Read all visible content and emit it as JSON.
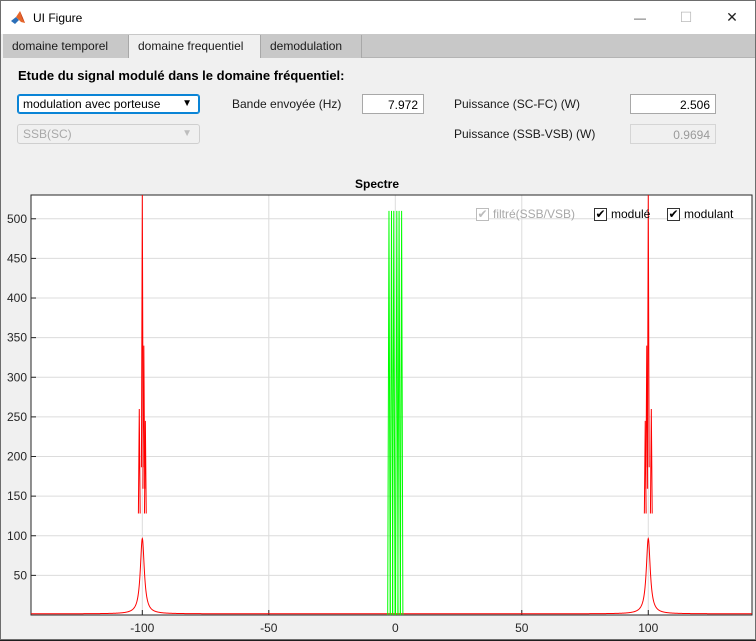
{
  "window": {
    "title": "UI Figure",
    "minimize_glyph": "—",
    "maximize_glyph": "☐",
    "close_glyph": "✕"
  },
  "tabs": [
    {
      "label": "domaine temporel",
      "active": false
    },
    {
      "label": "domaine frequentiel",
      "active": true
    },
    {
      "label": "demodulation",
      "active": false
    }
  ],
  "panel": {
    "heading": "Etude du signal modulé dans le domaine fréquentiel:",
    "modulation_select": {
      "value": "modulation avec porteuse"
    },
    "sideband_select": {
      "value": "SSB(SC)",
      "enabled": false
    },
    "bande_label": "Bande envoyée (Hz)",
    "bande_value": "7.972",
    "puissance_scfc_label": "Puissance (SC-FC) (W)",
    "puissance_scfc_value": "2.506",
    "puissance_ssb_label": "Puissance (SSB-VSB) (W)",
    "puissance_ssb_value": "0.9694"
  },
  "legend": {
    "filtre": {
      "label": "filtré(SSB/VSB)",
      "checked": true,
      "enabled": false
    },
    "module": {
      "label": "modulé",
      "checked": true,
      "enabled": true
    },
    "modulant": {
      "label": "modulant",
      "checked": true,
      "enabled": true
    }
  },
  "colors": {
    "module": "#ff0000",
    "modulant": "#00ff00",
    "grid": "#dcdcdc"
  },
  "chart_data": {
    "type": "line",
    "title": "Spectre",
    "xlabel": "",
    "ylabel": "",
    "xlim": [
      -144,
      141
    ],
    "ylim": [
      0,
      530
    ],
    "xticks": [
      -100,
      -50,
      0,
      50,
      100
    ],
    "yticks": [
      50,
      100,
      150,
      200,
      250,
      300,
      350,
      400,
      450,
      500
    ],
    "grid": true,
    "series": [
      {
        "name": "modulé",
        "color": "#ff0000",
        "carrier_hz": 100,
        "peaks": [
          {
            "x": -101.2,
            "y": 260
          },
          {
            "x": -100,
            "y": 530
          },
          {
            "x": -99.4,
            "y": 340
          },
          {
            "x": -98.8,
            "y": 245
          },
          {
            "x": 98.8,
            "y": 245
          },
          {
            "x": 99.4,
            "y": 340
          },
          {
            "x": 100,
            "y": 530
          },
          {
            "x": 101.2,
            "y": 260
          }
        ]
      },
      {
        "name": "modulant",
        "color": "#00ff00",
        "peaks": [
          {
            "x": -2.5,
            "y": 510
          },
          {
            "x": -1.5,
            "y": 510
          },
          {
            "x": -0.6,
            "y": 510
          },
          {
            "x": 0.6,
            "y": 510
          },
          {
            "x": 1.5,
            "y": 510
          },
          {
            "x": 2.5,
            "y": 510
          }
        ]
      }
    ]
  }
}
